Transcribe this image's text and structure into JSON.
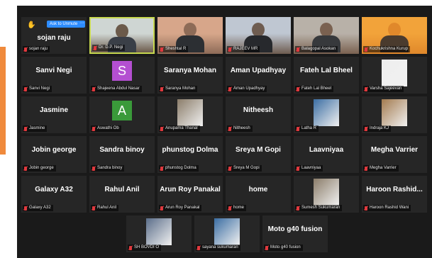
{
  "colors": {
    "accent_orange": "#f08a3c",
    "stage_bg": "#1a1a1a",
    "tile_bg": "#262626",
    "active_border": "#c7d84f",
    "muted_red": "#e0393e",
    "button_blue": "#2d8cff"
  },
  "raised_hand_tile": {
    "name": "sojan raju",
    "label": "sojan raju",
    "button_label": "Ask to Unmute",
    "more_label": "···",
    "hand_icon": "raised-hand-icon"
  },
  "tiles": [
    {
      "name": "",
      "label": "Dr. D.P. Negi",
      "kind": "video",
      "active": true
    },
    {
      "name": "",
      "label": "Sheshtal R",
      "kind": "video"
    },
    {
      "name": "",
      "label": "RAJEEV MR",
      "kind": "video"
    },
    {
      "name": "",
      "label": "Balagopal Asokan",
      "kind": "video"
    },
    {
      "name": "",
      "label": "Kochukrishna Kurup",
      "kind": "video"
    },
    {
      "name": "Sanvi Negi",
      "label": "Sanvi Negi"
    },
    {
      "name": "",
      "label": "Shajeena Abdul Nasar",
      "kind": "letter",
      "letter": "S",
      "avatar_color": "#b44fd1"
    },
    {
      "name": "Saranya Mohan",
      "label": "Saranya Mohan"
    },
    {
      "name": "Aman Upadhyay",
      "label": "Aman Upadhyay"
    },
    {
      "name": "Fateh Lal Bheel",
      "label": "Fateh Lal Bheel"
    },
    {
      "name": "",
      "label": "Varsha Sajeevan",
      "kind": "thumb"
    },
    {
      "name": "Jasmine",
      "label": "Jasmine"
    },
    {
      "name": "",
      "label": "Aswathi Ob",
      "kind": "letter",
      "letter": "A",
      "avatar_color": "#3a9a3a"
    },
    {
      "name": "",
      "label": "Anupama Thanal",
      "kind": "thumb"
    },
    {
      "name": "Nitheesh",
      "label": "Nitheesh"
    },
    {
      "name": "",
      "label": "Latha R",
      "kind": "thumb"
    },
    {
      "name": "",
      "label": "Indraja KJ",
      "kind": "thumb"
    },
    {
      "name": "Jobin george",
      "label": "Jobin george"
    },
    {
      "name": "Sandra binoy",
      "label": "Sandra binoy"
    },
    {
      "name": "phunstog Dolma",
      "label": "phunstog Dolma"
    },
    {
      "name": "Sreya M Gopi",
      "label": "Sreya M Gopi"
    },
    {
      "name": "Laavniyaa",
      "label": "Laavniyaa"
    },
    {
      "name": "Megha Varrier",
      "label": "Megha Varrier"
    },
    {
      "name": "Galaxy A32",
      "label": "Galaxy A32"
    },
    {
      "name": "Rahul Anil",
      "label": "Rahul Anil"
    },
    {
      "name": "Arun Roy Panakal",
      "label": "Arun Roy Panakal"
    },
    {
      "name": "home",
      "label": "home"
    },
    {
      "name": "",
      "label": "Sumesh Sukumaran",
      "kind": "thumb"
    },
    {
      "name": "Haroon Rashid...",
      "label": "Haroon Rashid Wani"
    }
  ],
  "last_row": [
    {
      "name": "",
      "label": "SH BOVDI O",
      "kind": "thumb"
    },
    {
      "name": "",
      "label": "sayana sukumaran",
      "kind": "thumb"
    },
    {
      "name": "Moto g40 fusion",
      "label": "Moto g40 fusion"
    }
  ]
}
